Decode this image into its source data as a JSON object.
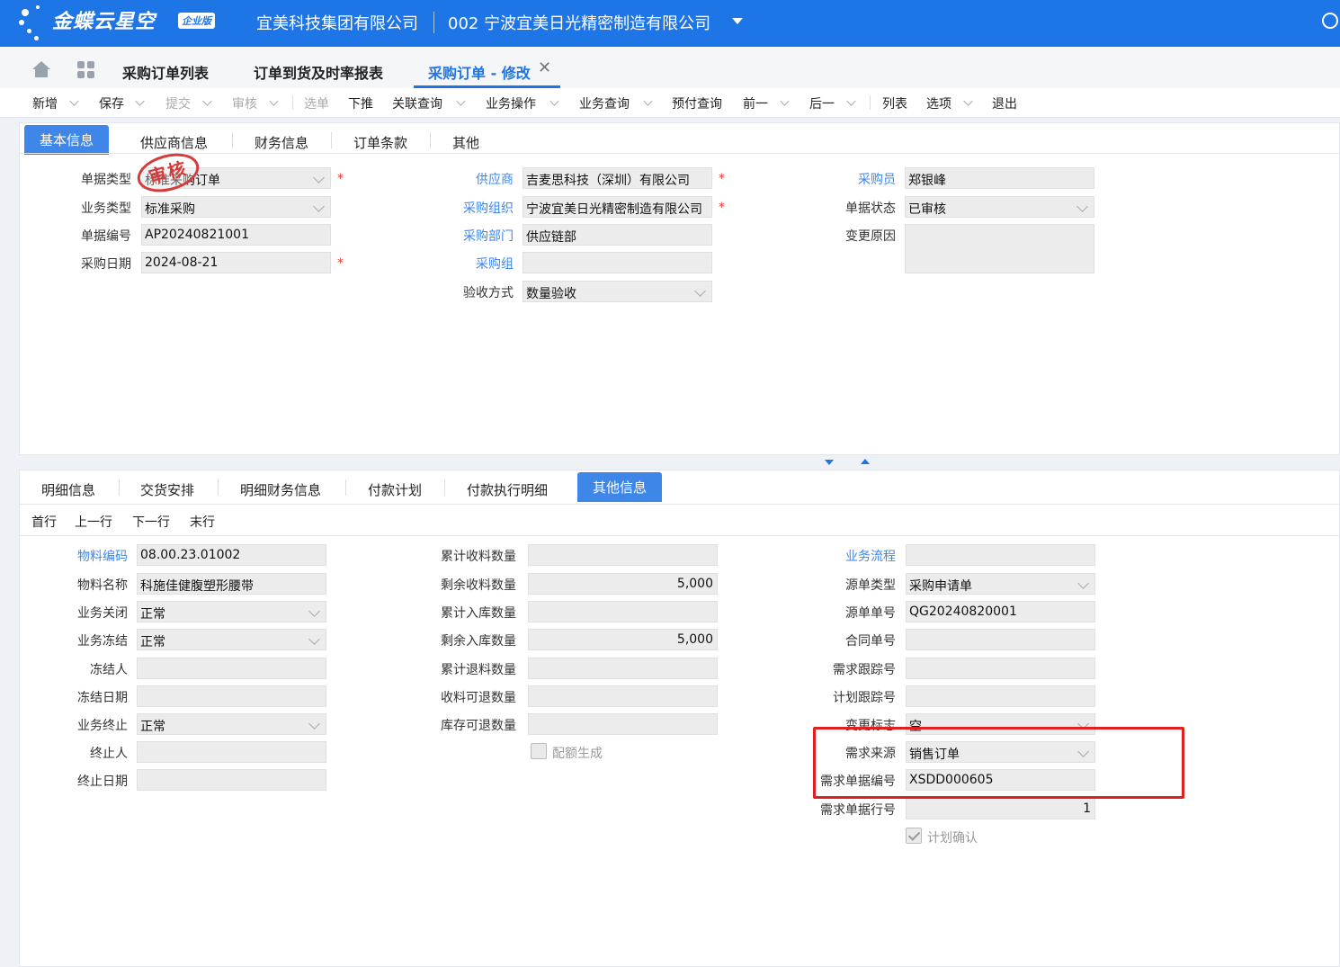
{
  "app": {
    "brand": "金蝶云星空",
    "brand_badge": "企业版",
    "company": "宜美科技集团有限公司",
    "org": "002  宁波宜美日光精密制造有限公司"
  },
  "page_tabs": [
    "采购订单列表",
    "订单到货及时率报表",
    "采购订单 - 修改"
  ],
  "toolbar": [
    "新增",
    "保存",
    "提交",
    "审核",
    "选单",
    "下推",
    "关联查询",
    "业务操作",
    "业务查询",
    "预付查询",
    "前一",
    "后一",
    "列表",
    "选项",
    "退出"
  ],
  "form_tabs": [
    "基本信息",
    "供应商信息",
    "财务信息",
    "订单条款",
    "其他"
  ],
  "stamp": "审核",
  "header_fields": {
    "bill_type": {
      "label": "单据类型",
      "value": "标准采购订单"
    },
    "biz_type": {
      "label": "业务类型",
      "value": "标准采购"
    },
    "bill_no": {
      "label": "单据编号",
      "value": "AP20240821001"
    },
    "date": {
      "label": "采购日期",
      "value": "2024-08-21"
    },
    "supplier": {
      "label": "供应商",
      "value": "吉麦思科技（深圳）有限公司"
    },
    "purchase_org": {
      "label": "采购组织",
      "value": "宁波宜美日光精密制造有限公司"
    },
    "purchase_dept": {
      "label": "采购部门",
      "value": "供应链部"
    },
    "purchase_group": {
      "label": "采购组",
      "value": ""
    },
    "accept_method": {
      "label": "验收方式",
      "value": "数量验收"
    },
    "buyer": {
      "label": "采购员",
      "value": "郑银峰"
    },
    "status": {
      "label": "单据状态",
      "value": "已审核"
    },
    "change_reason": {
      "label": "变更原因",
      "value": ""
    }
  },
  "detail_tabs": [
    "明细信息",
    "交货安排",
    "明细财务信息",
    "付款计划",
    "付款执行明细",
    "其他信息"
  ],
  "row_nav": [
    "首行",
    "上一行",
    "下一行",
    "末行"
  ],
  "detail_col1": [
    {
      "label": "物料编码",
      "value": "08.00.23.01002"
    },
    {
      "label": "物料名称",
      "value": "科施佳健腹塑形腰带"
    },
    {
      "label": "业务关闭",
      "value": "正常"
    },
    {
      "label": "业务冻结",
      "value": "正常"
    },
    {
      "label": "冻结人",
      "value": ""
    },
    {
      "label": "冻结日期",
      "value": ""
    },
    {
      "label": "业务终止",
      "value": "正常"
    },
    {
      "label": "终止人",
      "value": ""
    },
    {
      "label": "终止日期",
      "value": ""
    }
  ],
  "detail_col2": [
    {
      "label": "累计收料数量",
      "value": ""
    },
    {
      "label": "剩余收料数量",
      "value": "5,000"
    },
    {
      "label": "累计入库数量",
      "value": ""
    },
    {
      "label": "剩余入库数量",
      "value": "5,000"
    },
    {
      "label": "累计退料数量",
      "value": ""
    },
    {
      "label": "收料可退数量",
      "value": ""
    },
    {
      "label": "库存可退数量",
      "value": ""
    }
  ],
  "quota_checkbox": "配额生成",
  "detail_col3": [
    {
      "label": "业务流程",
      "value": ""
    },
    {
      "label": "源单类型",
      "value": "采购申请单"
    },
    {
      "label": "源单单号",
      "value": "QG20240820001"
    },
    {
      "label": "合同单号",
      "value": ""
    },
    {
      "label": "需求跟踪号",
      "value": ""
    },
    {
      "label": "计划跟踪号",
      "value": ""
    },
    {
      "label": "变更标志",
      "value": "空"
    },
    {
      "label": "需求来源",
      "value": "销售订单"
    },
    {
      "label": "需求单据编号",
      "value": "XSDD000605"
    },
    {
      "label": "需求单据行号",
      "value": "1"
    }
  ],
  "plan_checkbox": "计划确认",
  "colors": {
    "accent": "#1e75e6",
    "highlight_box": "#e02020"
  }
}
